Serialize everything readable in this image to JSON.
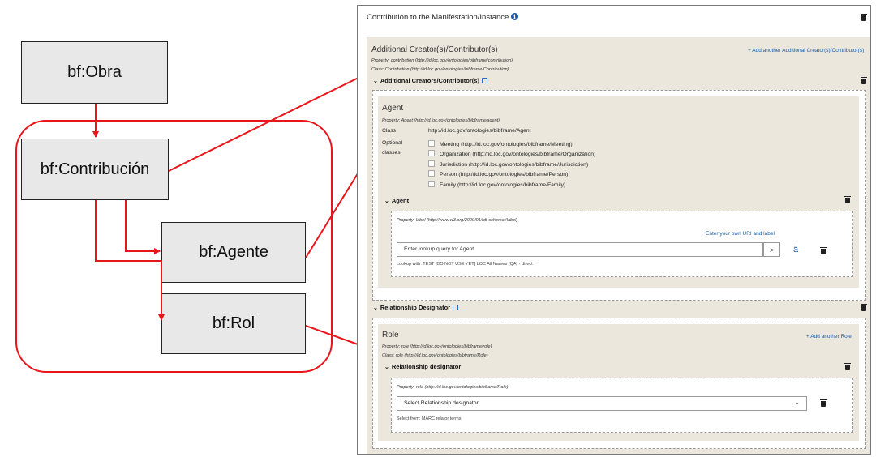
{
  "diagram": {
    "nodes": {
      "obra": "bf:Obra",
      "contribucion": "bf:Contribución",
      "agente": "bf:Agente",
      "rol": "bf:Rol"
    },
    "colors": {
      "arrow": "#e8151b",
      "node_fill": "#e8e8e8",
      "group_border": "#e8151b"
    }
  },
  "panel": {
    "title": "Contribution to the Manifestation/Instance",
    "info_icon": "i",
    "creators": {
      "title": "Additional Creator(s)/Contributor(s)",
      "add_link": "+ Add another Additional Creator(s)/Contributor(s)",
      "property": "Property: contribution (http://id.loc.gov/ontologies/bibframe/contribution)",
      "class": "Class: Contribution (http://id.loc.gov/ontologies/bibframe/Contribution)",
      "toggle": "Additional Creators/Contributor(s)"
    },
    "agent": {
      "title": "Agent",
      "property": "Property: Agent (http://id.loc.gov/ontologies/bibframe/agent)",
      "class_label": "Class",
      "class_value": "http://id.loc.gov/ontologies/bibframe/Agent",
      "optional_label_1": "Optional",
      "optional_label_2": "classes",
      "optional_classes": [
        "Meeting (http://id.loc.gov/ontologies/bibframe/Meeting)",
        "Organization (http://id.loc.gov/ontologies/bibframe/Organization)",
        "Jurisdiction (http://id.loc.gov/ontologies/bibframe/Jurisdiction)",
        "Person (http://id.loc.gov/ontologies/bibframe/Person)",
        "Family (http://id.loc.gov/ontologies/bibframe/Family)"
      ],
      "toggle": "Agent",
      "label_property": "Property: label (http://www.w3.org/2000/01/rdf-schema#label)",
      "own_uri_link": "Enter your own URI and label",
      "lookup_placeholder": "Enter lookup query for Agent",
      "lang_char": "ä",
      "lookup_note": "Lookup with: TEST [DO NOT USE YET] LOC All Names (QA) - direct"
    },
    "relationship": {
      "toggle": "Relationship Designator",
      "role_title": "Role",
      "add_role_link": "+ Add another Role",
      "property": "Property: role (http://id.loc.gov/ontologies/bibframe/role)",
      "class": "Class: role (http://id.loc.gov/ontologies/bibframe/Role)",
      "designator_toggle": "Relationship designator",
      "role_property": "Property: role (http://id.loc.gov/ontologies/bibframe/Role)",
      "select_label": "Select Relationship designator",
      "select_note": "Select from: MARC relator terms"
    }
  }
}
